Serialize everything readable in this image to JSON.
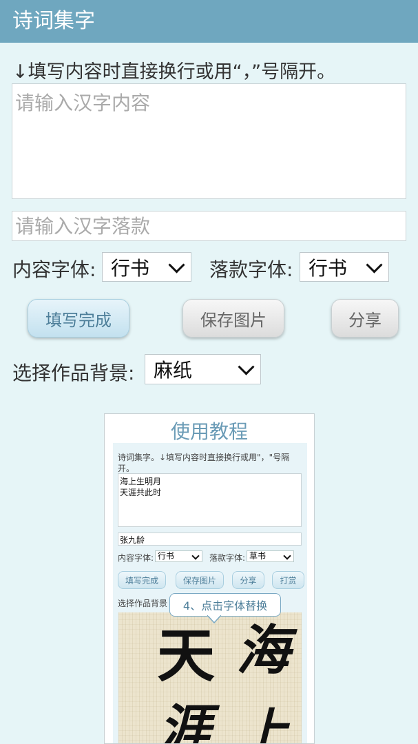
{
  "app": {
    "title": "诗词集字"
  },
  "form": {
    "instruction": "↓填写内容时直接换行或用“，”号隔开。",
    "content_placeholder": "请输入汉字内容",
    "signature_placeholder": "请输入汉字落款",
    "content_font_label": "内容字体:",
    "content_font_value": "行书",
    "signature_font_label": "落款字体:",
    "signature_font_value": "行书",
    "background_label": "选择作品背景:",
    "background_value": "麻纸"
  },
  "buttons": {
    "done": "填写完成",
    "save": "保存图片",
    "share": "分享"
  },
  "tutorial": {
    "title": "使用教程",
    "instruction": "诗词集字。↓填写内容时直接换行或用\"，\"号隔",
    "instruction_cont": "开。",
    "content_line1": "海上生明月",
    "content_line2": "天涯共此时",
    "signature": "张九龄",
    "content_font_label": "内容字体:",
    "content_font_value": "行书",
    "signature_font_label": "落款字体:",
    "signature_font_value": "草书",
    "btn_done": "填写完成",
    "btn_save": "保存图片",
    "btn_share": "分享",
    "btn_tip": "打赏",
    "background_label": "选择作品背景",
    "callout": "4、点击字体替换",
    "calligraphy": [
      "天",
      "海",
      "涯",
      "上"
    ]
  },
  "colors": {
    "appbar": "#6fa7bf",
    "background": "#e6f5f7",
    "accent": "#4d7e99"
  }
}
